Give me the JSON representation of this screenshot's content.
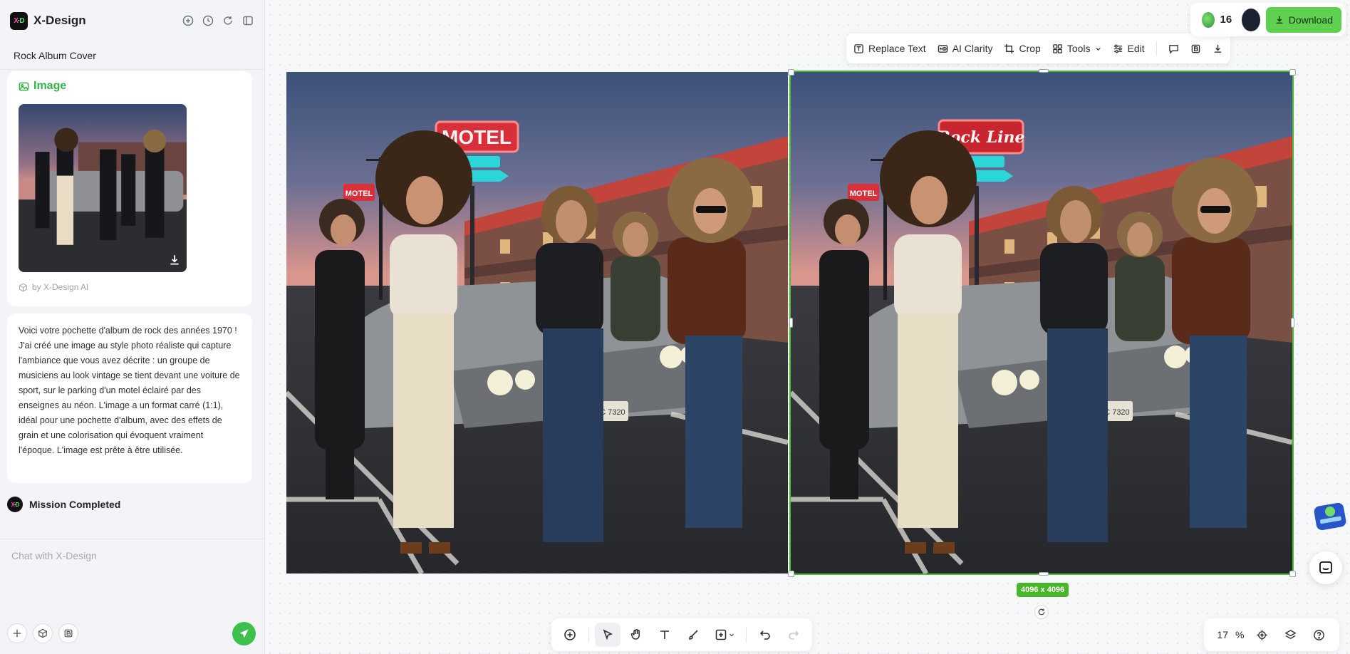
{
  "app": {
    "name": "X-Design",
    "logo_text": "X·D"
  },
  "sidebar": {
    "project_title": "Rock Album Cover",
    "image_card": {
      "label": "Image",
      "byline": "by X-Design AI"
    },
    "message": "Voici votre pochette d'album de rock des années 1970 ! J'ai créé une image au style photo réaliste qui capture l'ambiance que vous avez décrite : un groupe de musiciens au look vintage se tient devant une voiture de sport, sur le parking d'un motel éclairé par des enseignes au néon. L'image a un format carré (1:1), idéal pour une pochette d'album, avec des effets de grain et une colorisation qui évoquent vraiment l'époque. L'image est prête à être utilisée.",
    "mission_status": "Mission Completed",
    "chat_placeholder": "Chat with X-Design"
  },
  "toolbar": {
    "replace_text": "Replace Text",
    "ai_clarity": "AI Clarity",
    "crop": "Crop",
    "tools": "Tools",
    "edit": "Edit"
  },
  "top_right": {
    "credits": "16",
    "download_label": "Download"
  },
  "canvas": {
    "size_badge": "4096 x 4096",
    "left_sign": "MOTEL",
    "right_sign": "Rock Line",
    "small_sign": "MOTEL",
    "plate": "NDC 7320"
  },
  "zoom": {
    "value": "17",
    "unit": "%"
  },
  "colors": {
    "accent": "#4dbb2f",
    "download_bg": "#5fd04f",
    "label_green": "#35b34a"
  }
}
